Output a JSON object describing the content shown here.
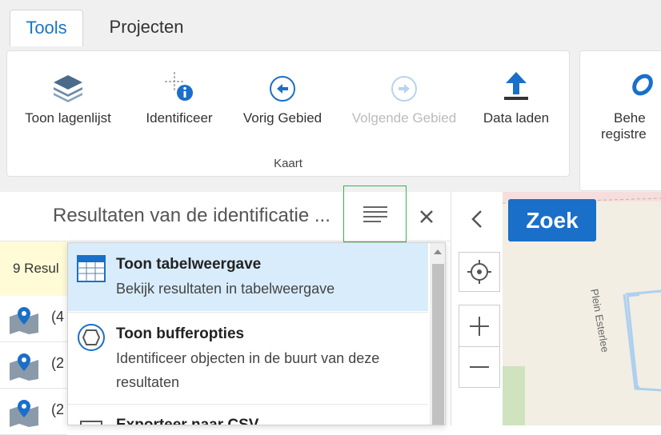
{
  "tabs": [
    {
      "label": "Tools",
      "active": true
    },
    {
      "label": "Projecten",
      "active": false
    }
  ],
  "ribbon": {
    "group_label": "Kaart",
    "tools": [
      {
        "label": "Toon lagenlijst",
        "icon": "layers-icon",
        "enabled": true
      },
      {
        "label": "Identificeer",
        "icon": "identify-icon",
        "enabled": true
      },
      {
        "label": "Vorig Gebied",
        "icon": "previous-extent-icon",
        "enabled": true
      },
      {
        "label": "Volgende Gebied",
        "icon": "next-extent-icon",
        "enabled": false
      },
      {
        "label": "Data laden",
        "icon": "upload-icon",
        "enabled": true
      }
    ],
    "partial_tool": {
      "line1": "Behe",
      "line2": "registre"
    }
  },
  "panel": {
    "title": "Resultaten van de identificatie ...",
    "results_summary": "9 Resul",
    "rows": [
      {
        "count": "(4"
      },
      {
        "count": "(2"
      },
      {
        "count": "(2"
      }
    ]
  },
  "menu": {
    "items": [
      {
        "title": "Toon tabelweergave",
        "desc": "Bekijk resultaten in tabelweergave",
        "icon": "table-icon",
        "selected": true
      },
      {
        "title": "Toon bufferopties",
        "desc": "Identificeer objecten in de buurt van deze resultaten",
        "icon": "buffer-icon",
        "selected": false
      },
      {
        "title": "Exporteer naar CSV",
        "desc": "",
        "icon": "csv-icon",
        "selected": false
      }
    ]
  },
  "map": {
    "search_label": "Zoek",
    "street_label": "Plein Esterlee"
  },
  "colors": {
    "accent": "#1a6fc9",
    "highlight": "#2db84b",
    "selected_bg": "#d9ecfb"
  }
}
